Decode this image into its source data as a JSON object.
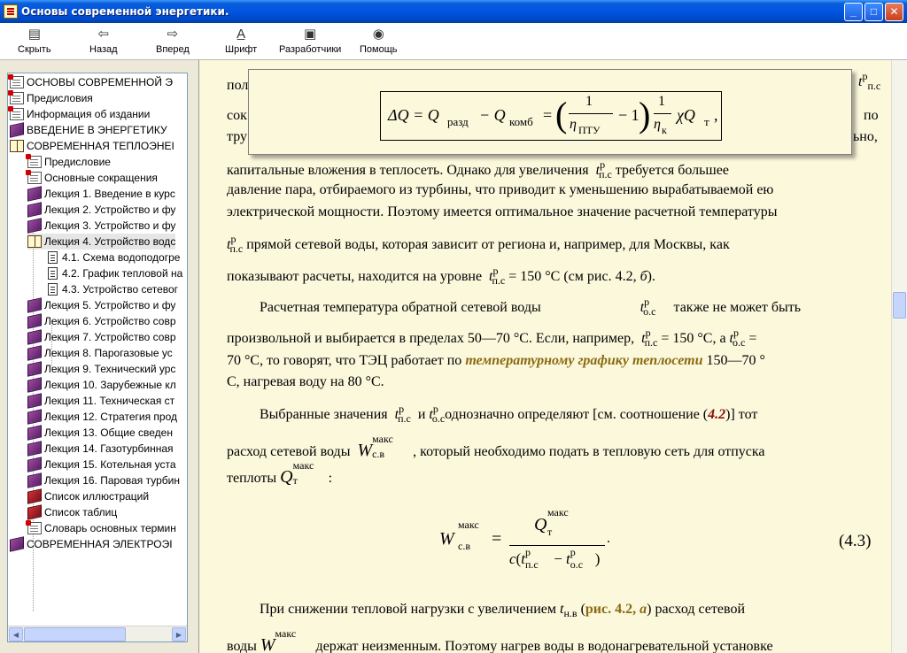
{
  "window": {
    "title": "Основы современной энергетики."
  },
  "toolbar": {
    "items": [
      {
        "label": "Скрыть",
        "icon": "hide-icon"
      },
      {
        "label": "Назад",
        "icon": "back-arrow-icon"
      },
      {
        "label": "Вперед",
        "icon": "forward-arrow-icon"
      },
      {
        "label": "Шрифт",
        "icon": "font-icon"
      },
      {
        "label": "Разработчики",
        "icon": "developers-icon"
      },
      {
        "label": "Помощь",
        "icon": "help-icon"
      }
    ]
  },
  "tree": {
    "items": [
      "ОСНОВЫ СОВРЕМЕННОЙ Э",
      "Предисловия",
      "Информация об издании",
      "ВВЕДЕНИЕ В ЭНЕРГЕТИКУ",
      "СОВРЕМЕННАЯ ТЕПЛОЭНЕІ",
      "Предисловие",
      "Основные сокращения",
      "Лекция 1. Введение в курс",
      "Лекция 2. Устройство и фу",
      "Лекция 3. Устройство и фу",
      "Лекция 4. Устройство водс",
      "4.1. Схема водоподогре",
      "4.2. График тепловой на",
      "4.3. Устройство сетевог",
      "Лекция 5. Устройство и фу",
      "Лекция 6. Устройство совр",
      "Лекция 7. Устройство совр",
      "Лекция 8. Парогазовые ус",
      "Лекция 9. Технический урс",
      "Лекция 10. Зарубежные кл",
      "Лекция 11. Техническая ст",
      "Лекция 12. Стратегия прод",
      "Лекция 13. Общие сведен",
      "Лекция 14. Газотурбинная",
      "Лекция 15. Котельная уста",
      "Лекция 16. Паровая турбин",
      "Список иллюстраций",
      "Список таблиц",
      "Словарь основных термин",
      "СОВРЕМЕННАЯ ЭЛЕКТРОЭІ"
    ]
  },
  "content": {
    "p1": {
      "l1": "пол",
      "l2": "сок",
      "l2r": "по",
      "l3": "тру",
      "l3r": "ьно,",
      "l4a": "капитальные вложения в теплосеть. Однако для увеличения",
      "l4b": "требуется большее",
      "l5": "давление пара, отбираемого из турбины, что приводит к уменьшению вырабатываемой ею",
      "l6": "электрической мощности. Поэтому имеется оптимальное значение расчетной температуры",
      "l7": "прямой сетевой воды, которая зависит от региона и, например, для Москвы, как",
      "l8a": "показывают расчеты, находится на уровне",
      "l8b": "= 150 °С (см рис. 4.2,",
      "l8c": "б",
      "l8d": ")."
    },
    "p2": {
      "l1a": "Расчетная температура обратной сетевой воды",
      "l1b": "также не может быть",
      "l2a": "произвольной и выбирается в пределах 50—70 °С. Если, например,",
      "l2b": "= 150 °С, а",
      "l2c": "=",
      "l3a": "70 °С, то говорят, что ТЭЦ работает по",
      "l3term": "температурному графику теплосети",
      "l3b": "150—70 °",
      "l4": "С, нагревая воду на 80 °С."
    },
    "p3": {
      "l1a": "Выбранные значения",
      "l1b": "и",
      "l1c": "однозначно определяют [см. соотношение (",
      "l1ref": "4.2",
      "l1d": ")] тот",
      "l2a": "расход сетевой воды",
      "l2b": ", который необходимо подать в тепловую сеть для отпуска",
      "l3": "теплоты"
    },
    "eq_number": "(4.3)",
    "p4": {
      "l1a": "При снижении тепловой нагрузки с увеличением",
      "l1b": "(",
      "l1fig": "рис. 4.2,",
      "l1figa": "а",
      "l1c": ") расход сетевой",
      "l2a": "воды",
      "l2b": "держат неизменным. Поэтому нагрев воды в водонагревательной установке"
    }
  },
  "symbols": {
    "t": "t",
    "p": "р",
    "ps": "п.с",
    "os": "о.с",
    "W": "W",
    "Q": "Q",
    "maks": "макс",
    "sv": "с.в",
    "T": "т",
    "nv": "н.в",
    "c": "c"
  },
  "popup_formula": {
    "lhs": "ΔQ = Q",
    "sub_razd": "разд",
    "minus": "− Q",
    "sub_komb": "комб",
    "eq": "=",
    "one": "1",
    "eta": "η",
    "sub_ptu": "ПТУ",
    "minus_one": "− 1",
    "sub_k": "к",
    "chi": "χQ",
    "sub_t": "т",
    "tail": ","
  }
}
